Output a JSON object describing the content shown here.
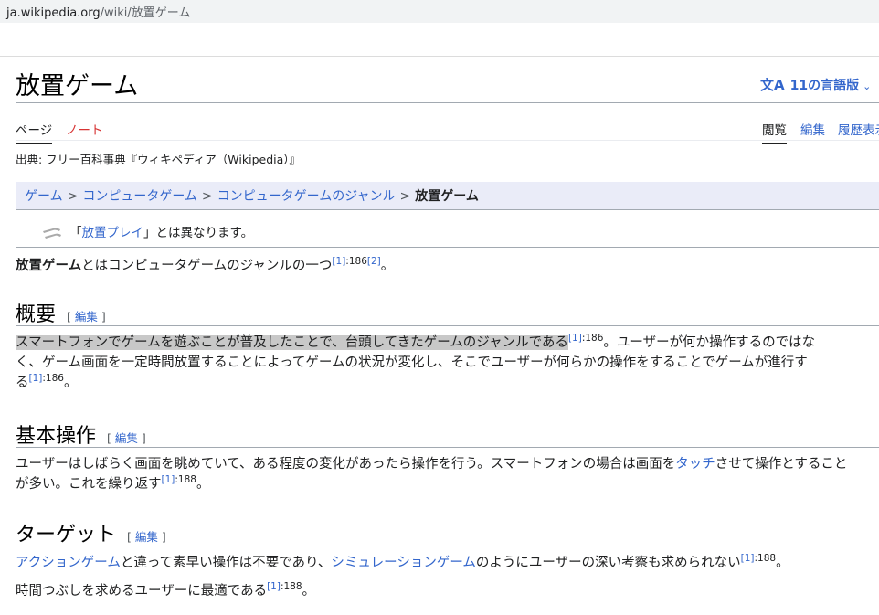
{
  "browser": {
    "url_host": "ja.wikipedia.org",
    "url_path": "/wiki/放置ゲーム"
  },
  "page": {
    "title": "放置ゲーム"
  },
  "languages": {
    "icon": "translate-icon",
    "label": "11の言語版"
  },
  "tabs": {
    "page": "ページ",
    "talk": "ノート",
    "read": "閲覧",
    "edit": "編集",
    "history": "履歴表示"
  },
  "source": "出典: フリー百科事典『ウィキペディア（Wikipedia）』",
  "breadcrumb": {
    "items": [
      "ゲーム",
      "コンピュータゲーム",
      "コンピュータゲームのジャンル"
    ],
    "current": "放置ゲーム",
    "separator": ">"
  },
  "hatnote": {
    "icon": "disambiguation-icon",
    "prefix": "「",
    "link": "放置プレイ",
    "suffix": "」とは異なります。"
  },
  "intro": {
    "bold": "放置ゲーム",
    "text": "とはコンピュータゲームのジャンルの一つ",
    "ref1": "[1]",
    "page1": ":186",
    "ref2": "[2]",
    "end": "。"
  },
  "sections": {
    "overview": {
      "heading": "概要",
      "edit_open": "[ ",
      "edit_label": "編集",
      "edit_close": " ]",
      "line1_highlight": "スマートフォンでゲームを遊ぶことが普及したことで、台頭してきたゲームのジャンルである",
      "line1_ref": "[1]",
      "line1_page": ":186",
      "line1_rest": "。ユーザーが何か操作するのではな",
      "line2": "く、ゲーム画面を一定時間放置することによってゲームの状況が変化し、そこでユーザーが何らかの操作をすることでゲームが進行す",
      "line3_start": "る",
      "line3_ref": "[1]",
      "line3_page": ":186",
      "line3_end": "。"
    },
    "basic": {
      "heading": "基本操作",
      "edit_open": "[ ",
      "edit_label": "編集",
      "edit_close": " ]",
      "line1_pre": "ユーザーはしばらく画面を眺めていて、ある程度の変化があったら操作を行う。スマートフォンの場合は画面を",
      "line1_link": "タッチ",
      "line1_post": "させて操作とすること",
      "line2": "が多い。これを繰り返す",
      "line2_ref": "[1]",
      "line2_page": ":188",
      "line2_end": "。"
    },
    "target": {
      "heading": "ターゲット",
      "edit_open": "[ ",
      "edit_label": "編集",
      "edit_close": " ]",
      "link1": "アクションゲーム",
      "text1": "と違って素早い操作は不要であり、",
      "link2": "シミュレーションゲーム",
      "text2": "のようにユーザーの深い考察も求められない",
      "ref1": "[1]",
      "page1": ":188",
      "end1": "。",
      "line2": "時間つぶしを求めるユーザーに最適である",
      "ref2": "[1]",
      "page2": ":188",
      "end2": "。"
    }
  }
}
